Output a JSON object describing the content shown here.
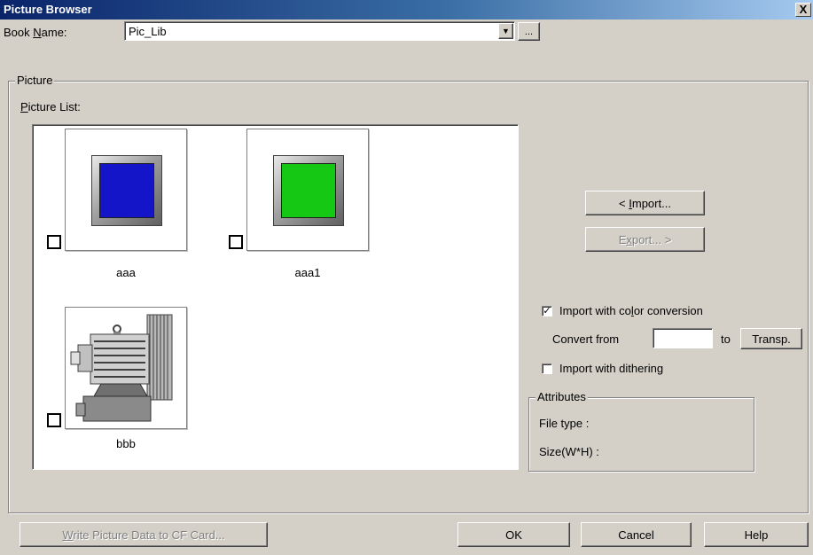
{
  "window": {
    "title": "Picture Browser",
    "close_glyph": "X"
  },
  "book": {
    "label": "Book Name:",
    "value": "Pic_Lib",
    "browse_label": "...",
    "dropdown_icon": "chevron-down-icon"
  },
  "picture_group": {
    "label": "Picture",
    "list_label": "Picture List:",
    "items": [
      {
        "name": "aaa",
        "checked": false,
        "thumbnail": "blue-square-button",
        "color": "#1414c8"
      },
      {
        "name": "aaa1",
        "checked": false,
        "thumbnail": "green-square-button",
        "color": "#14c814"
      },
      {
        "name": "bbb",
        "checked": false,
        "thumbnail": "motor-blower"
      }
    ]
  },
  "actions": {
    "import_label": "< Import...",
    "export_label": "Export... >"
  },
  "options": {
    "color_conversion_label": "Import with color conversion",
    "color_conversion_checked": true,
    "convert_from_label": "Convert from",
    "convert_from_value": "",
    "to_label": "to",
    "transp_label": "Transp.",
    "dithering_label": "Import with dithering",
    "dithering_checked": false
  },
  "attributes": {
    "label": "Attributes",
    "file_type_label": "File type :",
    "size_label": "Size(W*H) :"
  },
  "footer": {
    "write_label": "Write Picture Data to CF Card...",
    "ok_label": "OK",
    "cancel_label": "Cancel",
    "help_label": "Help"
  }
}
